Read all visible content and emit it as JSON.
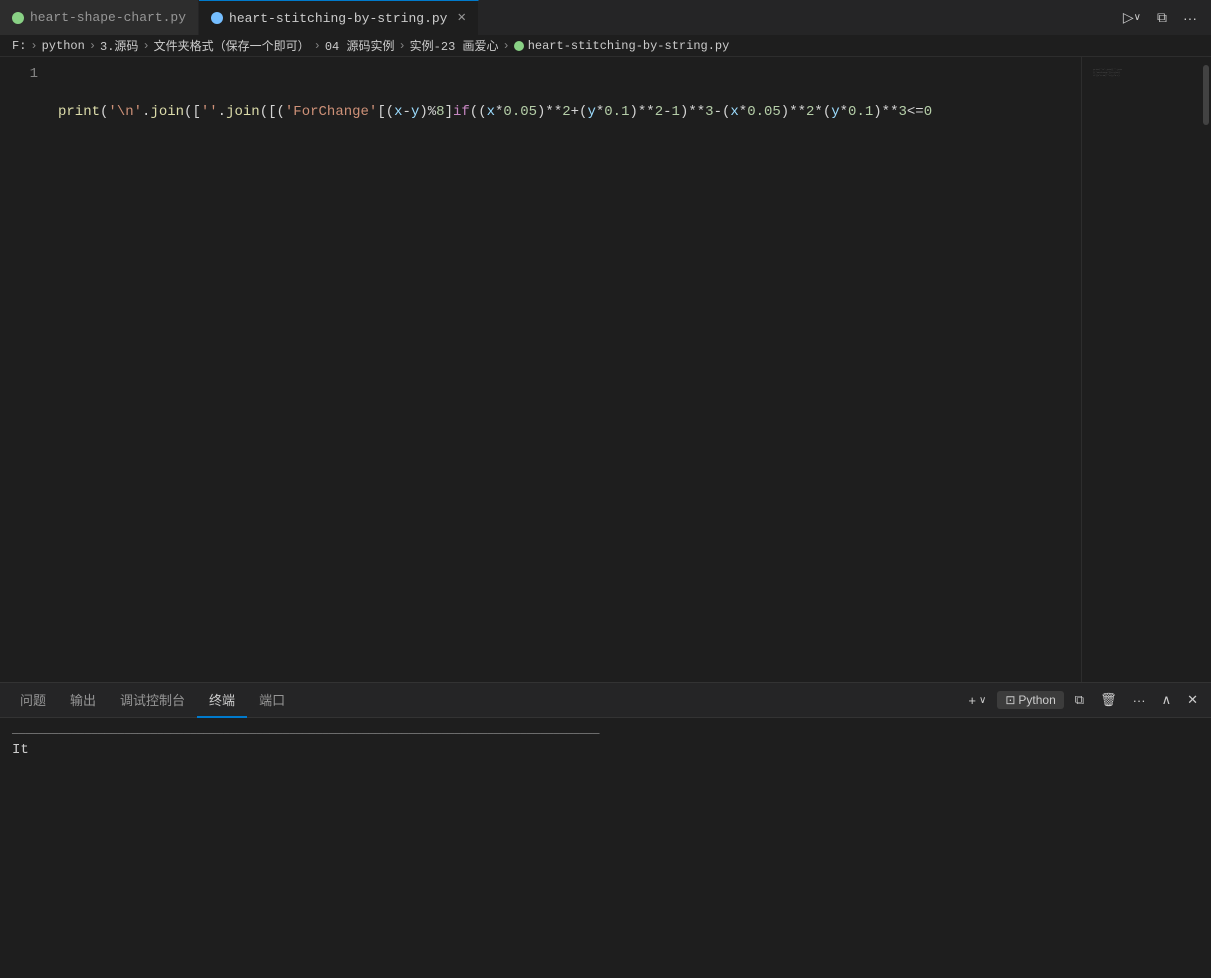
{
  "tabs": [
    {
      "id": "tab1",
      "label": "heart-shape-chart.py",
      "active": false,
      "icon_color": "green",
      "has_close": false
    },
    {
      "id": "tab2",
      "label": "heart-stitching-by-string.py",
      "active": true,
      "icon_color": "blue",
      "has_close": true
    }
  ],
  "tab_bar_actions": {
    "run_label": "▷",
    "split_label": "⧉",
    "more_label": "···"
  },
  "breadcrumb": {
    "items": [
      "F:",
      "python",
      "3.源码",
      "文件夹格式（保存一个即可）",
      "04 源码实例",
      "实例-23 画爱心",
      "💙 heart-stitching-by-string.py"
    ]
  },
  "editor": {
    "line_number": "1",
    "code": "    print('\\n'.join([''.join([('ForChange'[(x-y)%8]if((x*0.05)**2+(y*0.1)**2-1)**3-(x*0.05)**2*(y*0.1)**3<=0"
  },
  "panel": {
    "tabs": [
      "问题",
      "输出",
      "调试控制台",
      "终端",
      "端口"
    ],
    "active_tab": "终端",
    "actions": {
      "add": "+",
      "chevron": "∨",
      "terminal_icon": "⊡",
      "terminal_label": "Python",
      "split": "⧉",
      "trash": "🗑",
      "more": "···",
      "chevron_up": "∧",
      "close": "✕"
    }
  },
  "terminal": {
    "text": "It"
  }
}
